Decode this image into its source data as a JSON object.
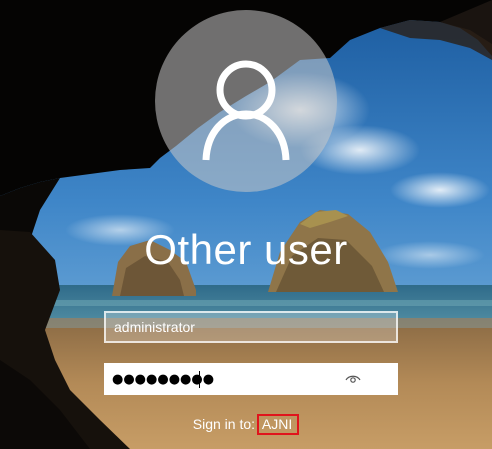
{
  "user": {
    "display_name": "Other user",
    "avatar_icon": "user-silhouette-icon"
  },
  "form": {
    "username_value": "administrator",
    "password_masked": "●●●●●●●●●",
    "reveal_icon": "eye-icon",
    "submit_icon": "arrow-right-icon"
  },
  "signin": {
    "prefix": "Sign in to:",
    "domain": "AJNI"
  },
  "colors": {
    "highlight_box": "#e0141c",
    "text": "#ffffff"
  }
}
